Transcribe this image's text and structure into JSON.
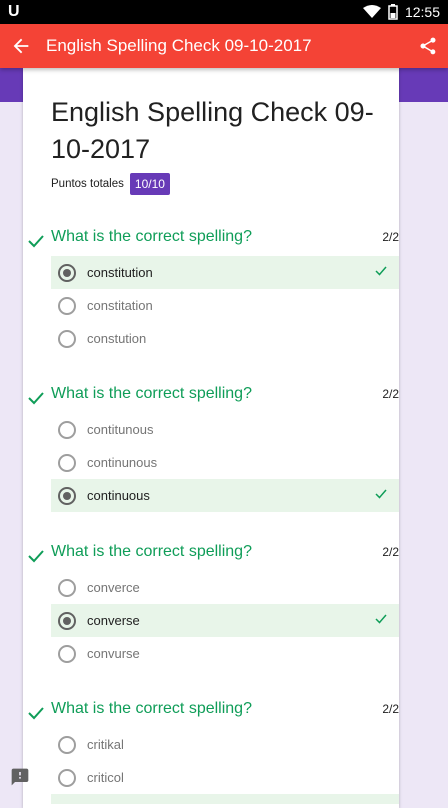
{
  "status_bar": {
    "carrier_icon": "U",
    "time": "12:55"
  },
  "toolbar": {
    "title": "English Spelling Check 09-10-2017"
  },
  "form": {
    "title": "English Spelling Check 09-10-2017",
    "points_label": "Puntos totales",
    "points_value": "10/10"
  },
  "colors": {
    "toolbar": "#f44336",
    "accent": "#673ab7",
    "correct": "#0f9d58",
    "correct_bg": "#e8f5e9"
  },
  "questions": [
    {
      "text": "What is the correct spelling?",
      "score": "2/2",
      "options": [
        "constitution",
        "constitation",
        "constution"
      ],
      "selected": 0
    },
    {
      "text": "What is the correct spelling?",
      "score": "2/2",
      "options": [
        "contitunous",
        "continunous",
        "continuous"
      ],
      "selected": 2
    },
    {
      "text": "What is the correct spelling?",
      "score": "2/2",
      "options": [
        "converce",
        "converse",
        "convurse"
      ],
      "selected": 1
    },
    {
      "text": "What is the correct spelling?",
      "score": "2/2",
      "options": [
        "critikal",
        "criticol"
      ],
      "selected": null
    }
  ]
}
